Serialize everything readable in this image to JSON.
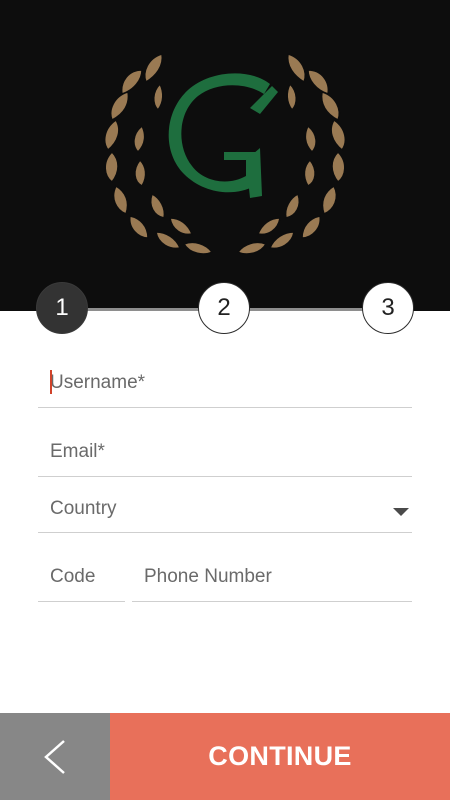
{
  "header": {
    "logo_letter": "G",
    "logo_color": "#1e6e3e",
    "wreath_color": "#9a7a53",
    "background": "#0d0d0d"
  },
  "stepper": {
    "current": 1,
    "steps": [
      "1",
      "2",
      "3"
    ]
  },
  "form": {
    "username_placeholder": "Username*",
    "email_placeholder": "Email*",
    "country_placeholder": "Country",
    "code_placeholder": "Code",
    "phone_placeholder": "Phone Number"
  },
  "footer": {
    "back_icon": "chevron-left-icon",
    "continue_label": "CONTINUE",
    "continue_color": "#e8705a",
    "back_color": "#878787"
  }
}
